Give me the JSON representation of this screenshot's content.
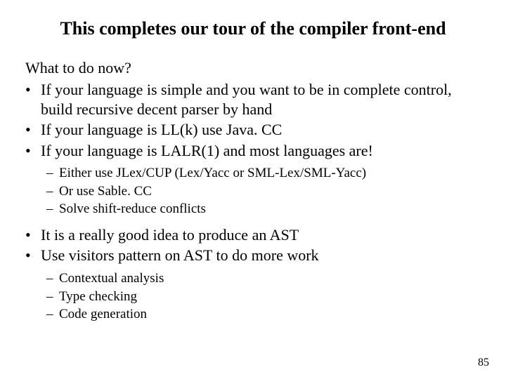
{
  "title": "This completes our tour of the compiler front-end",
  "lead": "What to do now?",
  "bullets1": [
    "If your language is simple and you want to be in complete control, build recursive decent parser by hand",
    "If your language is LL(k) use Java. CC",
    "If your language is LALR(1) and most languages are!"
  ],
  "sub1": [
    "Either use JLex/CUP (Lex/Yacc or SML-Lex/SML-Yacc)",
    "Or use Sable. CC",
    "Solve shift-reduce conflicts"
  ],
  "bullets2": [
    "It is a really good idea to produce an AST",
    "Use visitors pattern on AST to do more work"
  ],
  "sub2": [
    "Contextual analysis",
    "Type checking",
    "Code generation"
  ],
  "page": "85"
}
